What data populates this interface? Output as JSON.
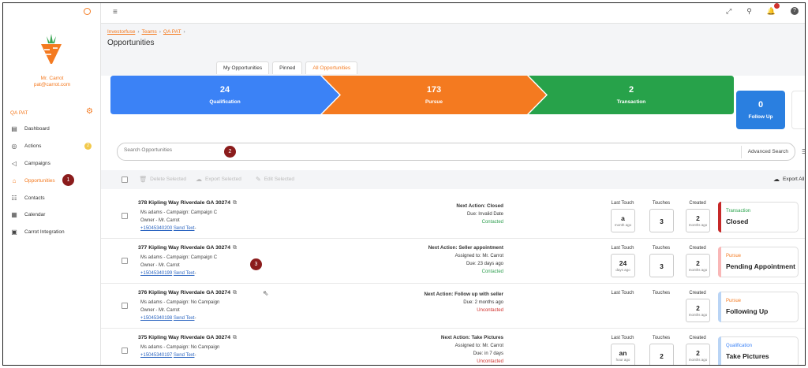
{
  "sidebar": {
    "user_name": "Mr. Carrot",
    "user_email": "pat@carrot.com",
    "team": "QA PAT",
    "nav": [
      {
        "label": "Dashboard",
        "icon": "dashboard-icon"
      },
      {
        "label": "Actions",
        "icon": "check-circle-icon",
        "badge": "2"
      },
      {
        "label": "Campaigns",
        "icon": "megaphone-icon"
      },
      {
        "label": "Opportunities",
        "icon": "home-icon",
        "active": true
      },
      {
        "label": "Contacts",
        "icon": "contacts-icon"
      },
      {
        "label": "Calendar",
        "icon": "calendar-icon"
      },
      {
        "label": "Carrot Integration",
        "icon": "integration-icon"
      }
    ]
  },
  "annotations": {
    "one": "1",
    "two": "2",
    "three": "3"
  },
  "breadcrumb": [
    "Investorfuse",
    "Teams",
    "QA PAT"
  ],
  "page_title": "Opportunities",
  "tabs": [
    "My Opportunities",
    "Pinned",
    "All Opportunities"
  ],
  "pipeline": [
    {
      "count": "24",
      "label": "Qualification",
      "color": "#3b82f6"
    },
    {
      "count": "173",
      "label": "Pursue",
      "color": "#f47a20"
    },
    {
      "count": "2",
      "label": "Transaction",
      "color": "#27a24a"
    },
    {
      "count": "0",
      "label": "Follow Up",
      "color": "#2a7fe0"
    }
  ],
  "search": {
    "placeholder": "Search Opportunities",
    "advanced": "Advanced Search"
  },
  "bulk": {
    "delete": "Delete Selected",
    "export": "Export Selected",
    "edit": "Edit Selected",
    "export_all": "Export All"
  },
  "columns": {
    "last_touch": "Last Touch",
    "touches": "Touches",
    "created": "Created"
  },
  "rows": [
    {
      "address": "378 Kipling Way Riverdale GA 30274",
      "line1": "Ms adams - Campaign: Campaign C",
      "line2": "Owner - Mr. Carrot",
      "phone": "+15045340200",
      "send": "Send Text",
      "next_action": "Next Action: Closed",
      "detail1": "",
      "detail2": "Due: Invalid Date",
      "contact": "Contacted",
      "contact_ok": true,
      "last_touch": "a",
      "last_touch_sub": "month ago",
      "touches": "3",
      "created": "2",
      "created_sub": "months ago",
      "stage": "Transaction",
      "stage_color": "#27a24a",
      "bar_color": "#c62828",
      "status": "Closed"
    },
    {
      "address": "377 Kipling Way Riverdale GA 30274",
      "line1": "Ms adams - Campaign: Campaign C",
      "line2": "Owner - Mr. Carrot",
      "phone": "+15045340199",
      "send": "Send Text",
      "next_action": "Next Action: Seller appointment",
      "detail1": "Assigned to: Mr. Carrot",
      "detail2": "Due: 23 days ago",
      "contact": "Contacted",
      "contact_ok": true,
      "last_touch": "24",
      "last_touch_sub": "days ago",
      "touches": "3",
      "created": "2",
      "created_sub": "months ago",
      "stage": "Pursue",
      "stage_color": "#f47a20",
      "bar_color": "#f9b7b7",
      "status": "Pending Appointment"
    },
    {
      "address": "376 Kipling Way Riverdale GA 30274",
      "line1": "Ms adams - Campaign: No Campaign",
      "line2": "Owner - Mr. Carrot",
      "phone": "+15045340198",
      "send": "Send Text",
      "next_action": "Next Action: Follow up with seller",
      "detail1": "",
      "detail2": "Due: 2 months ago",
      "contact": "Uncontacted",
      "contact_ok": false,
      "last_touch": "",
      "last_touch_sub": "",
      "touches": "",
      "created": "2",
      "created_sub": "months ago",
      "stage": "Pursue",
      "stage_color": "#f47a20",
      "bar_color": "#b9d4f5",
      "status": "Following Up"
    },
    {
      "address": "375 Kipling Way Riverdale GA 30274",
      "line1": "Ms adams - Campaign: No Campaign",
      "line2": "",
      "phone": "+15045340197",
      "send": "Send Text",
      "next_action": "Next Action: Take Pictures",
      "detail1": "Assigned to: Mr. Carrot",
      "detail2": "Due: in 7 days",
      "contact": "Uncontacted",
      "contact_ok": false,
      "last_touch": "an",
      "last_touch_sub": "hour ago",
      "touches": "2",
      "created": "2",
      "created_sub": "months ago",
      "stage": "Qualification",
      "stage_color": "#3b82f6",
      "bar_color": "#b9d4f5",
      "status": "Take Pictures"
    }
  ]
}
